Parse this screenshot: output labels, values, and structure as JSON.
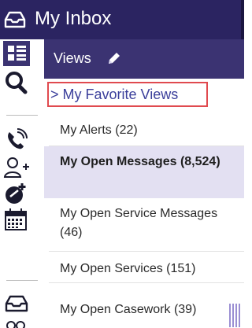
{
  "header": {
    "title": "My Inbox",
    "icon": "inbox-tray-icon",
    "bg": "#2b2461"
  },
  "views": {
    "label": "Views",
    "edit_icon": "pencil-icon",
    "bg": "#3b3372"
  },
  "favorite_views": {
    "label": "> My Favorite Views",
    "highlight_color": "#e04a4f"
  },
  "rail_icons": [
    "views-grid-icon",
    "search-icon",
    "phone-icon",
    "add-person-icon",
    "add-badge-icon",
    "calendar-icon",
    "inbox-tray-icon"
  ],
  "items": [
    {
      "label": "My Alerts (22)",
      "active": false
    },
    {
      "label": "My Open Messages (8,524)",
      "active": true
    },
    {
      "label": "My Open Service Messages (46)",
      "active": false
    },
    {
      "label": "My Open Services (151)",
      "active": false
    },
    {
      "label": "My Open Casework (39)",
      "active": false
    }
  ],
  "accent_colors": {
    "active_row": "#e3e0f2",
    "link": "#3b3f9b"
  }
}
